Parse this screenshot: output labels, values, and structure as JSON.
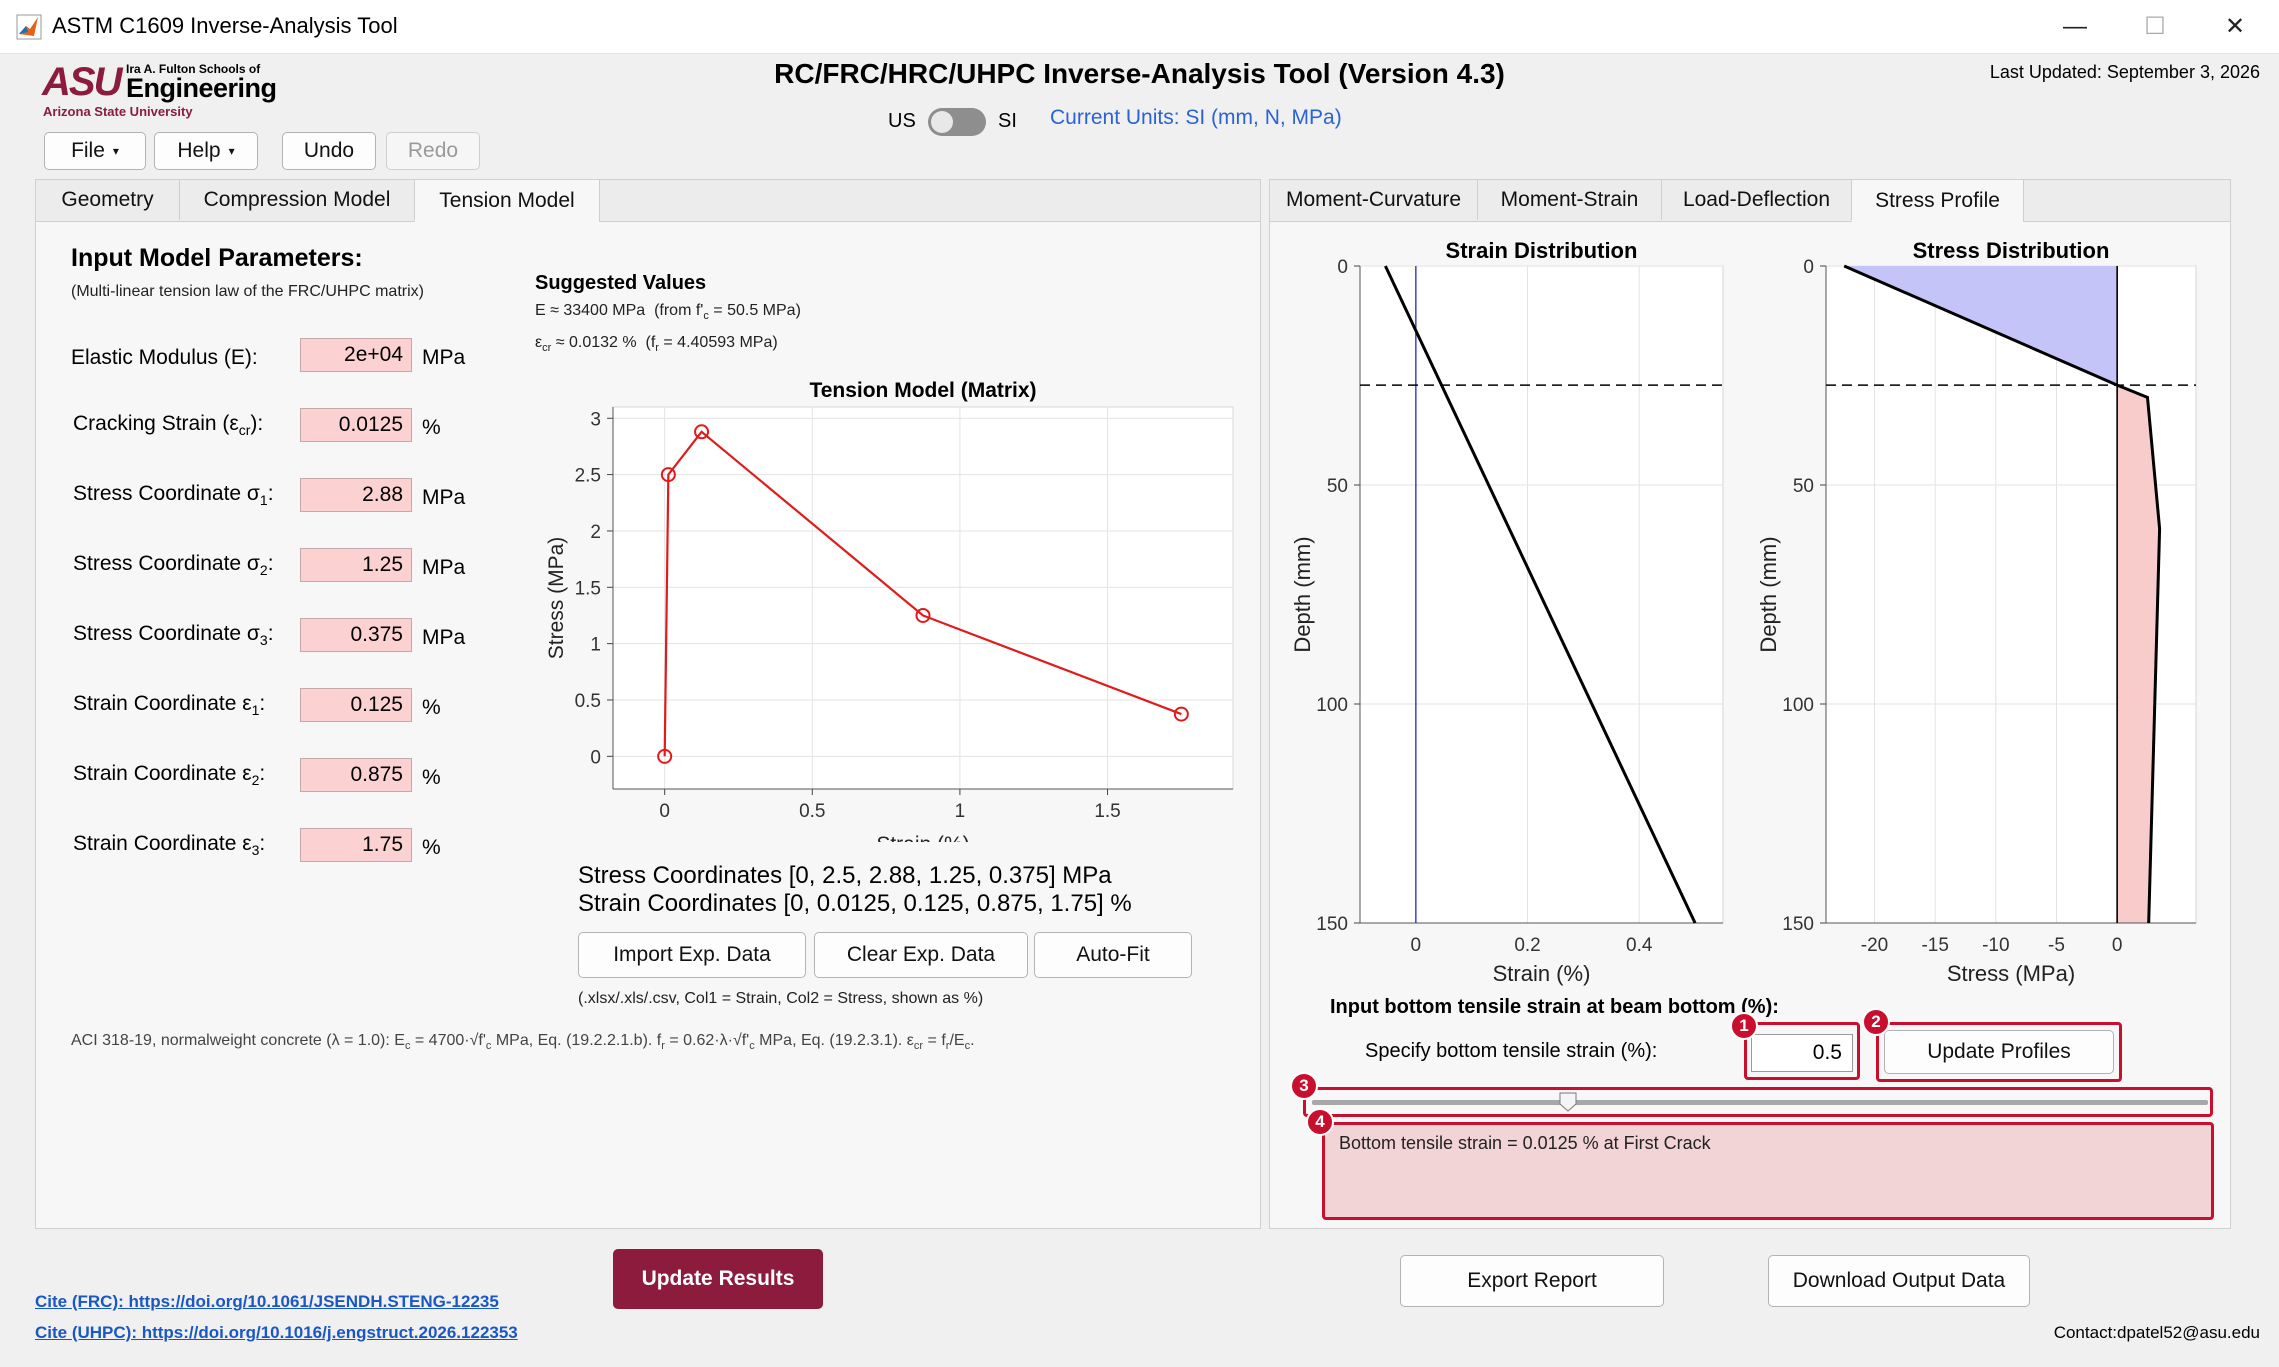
{
  "window": {
    "title": "ASTM C1609 Inverse-Analysis Tool",
    "minimize": "—",
    "maximize": "☐",
    "close": "✕"
  },
  "header": {
    "logo_top": "Ira A. Fulton Schools of",
    "logo_main": "Engineering",
    "logo_sub": "Arizona State University",
    "logo_mark": "ASU",
    "title": "RC/FRC/HRC/UHPC Inverse-Analysis Tool (Version 4.3)",
    "last_updated": "Last Updated: September 3, 2026",
    "unit_us": "US",
    "unit_si": "SI",
    "current_units": "Current Units: SI (mm, N, MPa)"
  },
  "menu": {
    "file": "File",
    "help": "Help",
    "undo": "Undo",
    "redo": "Redo",
    "dropdown_glyph": "▾"
  },
  "left_tabs": [
    "Geometry",
    "Compression Model",
    "Tension Model"
  ],
  "right_tabs": [
    "Moment-Curvature",
    "Moment-Strain",
    "Load-Deflection",
    "Stress Profile"
  ],
  "inputs": {
    "heading": "Input Model Parameters:",
    "subheading": "(Multi-linear tension law of the FRC/UHPC matrix)",
    "rows": [
      {
        "label": "Elastic Modulus (E):",
        "value": "2e+04",
        "unit": "MPa"
      },
      {
        "label": "Cracking Strain (εcr):",
        "value": "0.0125",
        "unit": "%"
      },
      {
        "label": "Stress Coordinate σ1:",
        "value": "2.88",
        "unit": "MPa"
      },
      {
        "label": "Stress Coordinate σ2:",
        "value": "1.25",
        "unit": "MPa"
      },
      {
        "label": "Stress Coordinate σ3:",
        "value": "0.375",
        "unit": "MPa"
      },
      {
        "label": "Strain Coordinate ε1:",
        "value": "0.125",
        "unit": "%"
      },
      {
        "label": "Strain Coordinate ε2:",
        "value": "0.875",
        "unit": "%"
      },
      {
        "label": "Strain Coordinate ε3:",
        "value": "1.75",
        "unit": "%"
      }
    ]
  },
  "suggested": {
    "title": "Suggested Values",
    "line1": "E ≈ 33400 MPa  (from f'c = 50.5 MPa)",
    "line2": "εcr ≈ 0.0132 %  (fr = 4.40593 MPa)"
  },
  "coords": {
    "stress": "Stress Coordinates [0, 2.5, 2.88, 1.25, 0.375] MPa",
    "strain": "Strain Coordinates [0, 0.0125, 0.125, 0.875, 1.75] %"
  },
  "exp_buttons": {
    "import": "Import Exp. Data",
    "clear": "Clear Exp. Data",
    "autofit": "Auto-Fit",
    "hint": "(.xlsx/.xls/.csv, Col1 = Strain, Col2 = Stress, shown as %)"
  },
  "aci_note": "ACI 318-19, normalweight concrete (λ = 1.0): Ec = 4700·√f'c MPa, Eq. (19.2.2.1.b). fr = 0.62·λ·√f'c MPa, Eq. (19.2.3.1). εcr = fr/Ec.",
  "profile": {
    "heading": "Input bottom tensile strain at beam bottom (%):",
    "label": "Specify bottom tensile strain (%):",
    "value": "0.5",
    "update": "Update Profiles",
    "slider_value": 0.5,
    "status": "Bottom tensile strain = 0.0125 % at First Crack",
    "badges": [
      "1",
      "2",
      "3",
      "4"
    ]
  },
  "bottom": {
    "cite_frc": "Cite (FRC): https://doi.org/10.1061/JSENDH.STENG-12235",
    "cite_uhpc": "Cite (UHPC): https://doi.org/10.1016/j.engstruct.2026.122353",
    "update_results": "Update Results",
    "export": "Export Report",
    "download": "Download Output Data",
    "contact": "Contact:dpatel52@asu.edu"
  },
  "chart_data": [
    {
      "type": "line",
      "title": "Tension Model (Matrix)",
      "xlabel": "Strain (%)",
      "ylabel": "Stress (MPa)",
      "x": [
        0,
        0.0125,
        0.125,
        0.875,
        1.75
      ],
      "y": [
        0,
        2.5,
        2.88,
        1.25,
        0.375
      ],
      "xlim": [
        -0.175,
        1.925
      ],
      "ylim": [
        -0.29,
        3.1
      ],
      "xticks": [
        "0",
        "0.5",
        "1",
        "1.5"
      ],
      "yticks": [
        "0",
        "0.5",
        "1",
        "1.5",
        "2",
        "2.5",
        "3"
      ],
      "grid": true,
      "color": "#e01b1b"
    },
    {
      "type": "line",
      "title": "Strain Distribution",
      "xlabel": "Strain (%)",
      "ylabel": "Depth (mm)",
      "depth": [
        0,
        150
      ],
      "strain": [
        -0.0545,
        0.5
      ],
      "neutral_axis_depth": 27.2,
      "xlim": [
        -0.1,
        0.55
      ],
      "ylim": [
        0,
        150
      ],
      "xticks": [
        "0",
        "0.2",
        "0.4"
      ],
      "yticks": [
        "0",
        "50",
        "100",
        "150"
      ],
      "grid": true
    },
    {
      "type": "area",
      "title": "Stress Distribution",
      "xlabel": "Stress (MPa)",
      "ylabel": "Depth (mm)",
      "depth": [
        0,
        27.2,
        30,
        60,
        150
      ],
      "stress": [
        -22.5,
        0,
        2.5,
        3.5,
        2.6
      ],
      "neutral_axis_depth": 27.2,
      "xlim": [
        -24,
        6.5
      ],
      "ylim": [
        0,
        150
      ],
      "xticks": [
        "-20",
        "-15",
        "-10",
        "-5",
        "0"
      ],
      "yticks": [
        "0",
        "50",
        "100",
        "150"
      ],
      "compression_color": "#c4c4f8",
      "tension_color": "#f9cccc",
      "grid": true
    }
  ],
  "colors": {
    "accent": "#8c1b3e",
    "link": "#1a57c6",
    "highlight": "#c8102e",
    "field": "#fbd1d1"
  }
}
